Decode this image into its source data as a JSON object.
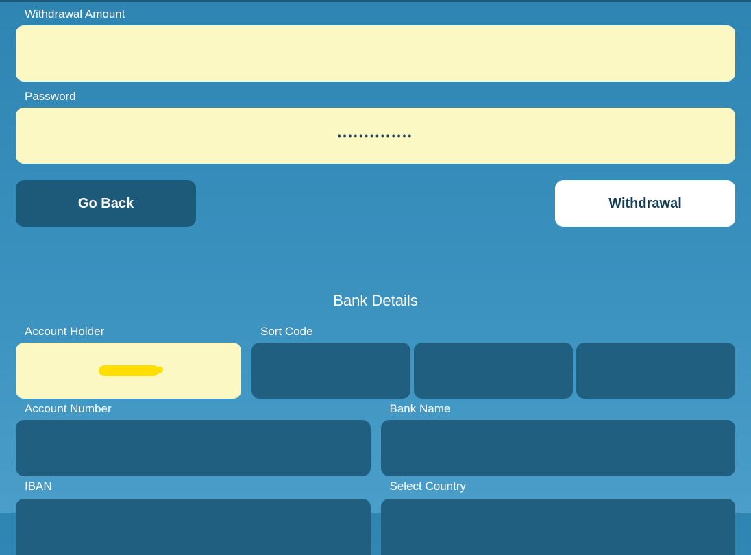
{
  "withdrawal": {
    "amount_label": "Withdrawal Amount",
    "amount_value": "",
    "password_label": "Password",
    "password_value": "••••••••••••••"
  },
  "buttons": {
    "go_back": "Go Back",
    "withdrawal": "Withdrawal"
  },
  "bank_details": {
    "section_title": "Bank Details",
    "account_holder_label": "Account Holder",
    "account_holder_value": "",
    "sort_code_label": "Sort Code",
    "sort_code_1": "",
    "sort_code_2": "",
    "sort_code_3": "",
    "account_number_label": "Account Number",
    "account_number_value": "",
    "bank_name_label": "Bank Name",
    "bank_name_value": "",
    "iban_label": "IBAN",
    "iban_value": "",
    "select_country_label": "Select Country",
    "select_country_value": ""
  }
}
